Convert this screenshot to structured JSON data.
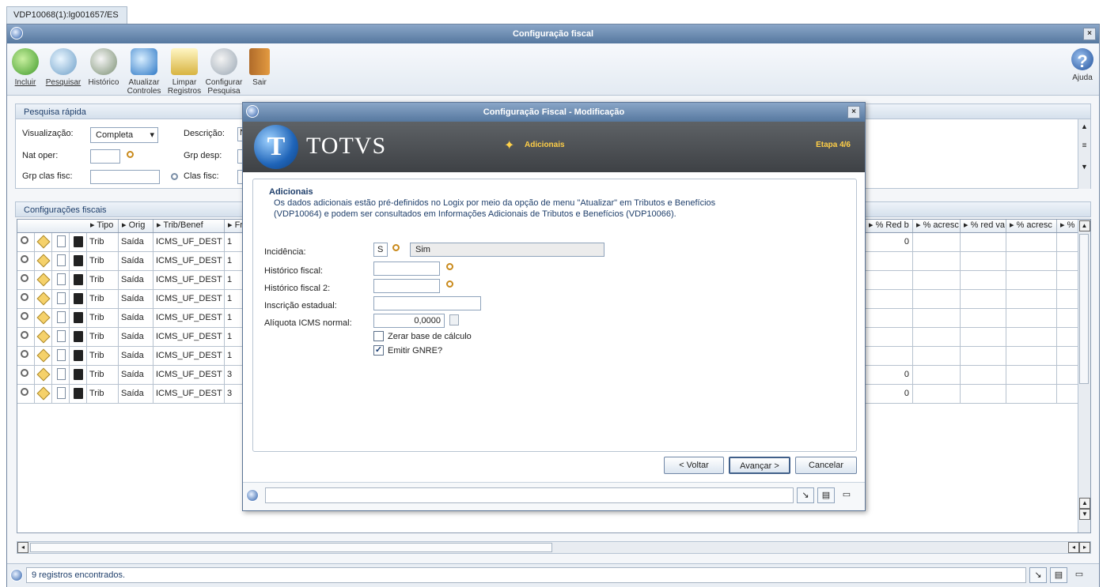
{
  "window_tab": "VDP10068(1):lg001657/ES",
  "main_title": "Configuração fiscal",
  "toolbar": {
    "incluir": "Incluir",
    "pesquisar": "Pesquisar",
    "historico": "Histórico",
    "atualizar_1": "Atualizar",
    "atualizar_2": "Controles",
    "limpar_1": "Limpar",
    "limpar_2": "Registros",
    "configurar_1": "Configurar",
    "configurar_2": "Pesquisa",
    "sair": "Sair",
    "ajuda": "Ajuda"
  },
  "quick_search": {
    "title": "Pesquisa rápida",
    "visualizacao_label": "Visualização:",
    "visualizacao_value": "Completa",
    "descricao_label": "Descrição:",
    "descricao_value": "N",
    "nat_oper_label": "Nat oper:",
    "grp_desp_label": "Grp desp:",
    "grp_clas_fisc_label": "Grp clas fisc:",
    "clas_fisc_label": "Clas fisc:"
  },
  "grid": {
    "title": "Configurações fiscais",
    "columns_left": [
      "Tipo",
      "Orig",
      "Trib/Benef",
      "Fr"
    ],
    "columns_right": [
      "% Red b",
      "% acresc",
      "% red va",
      "% acresc",
      "%"
    ],
    "rows": [
      {
        "tipo": "Trib",
        "orig": "Saída",
        "trib": "ICMS_UF_DEST",
        "fr": "1",
        "red": "0"
      },
      {
        "tipo": "Trib",
        "orig": "Saída",
        "trib": "ICMS_UF_DEST",
        "fr": "1",
        "red": ""
      },
      {
        "tipo": "Trib",
        "orig": "Saída",
        "trib": "ICMS_UF_DEST",
        "fr": "1",
        "red": ""
      },
      {
        "tipo": "Trib",
        "orig": "Saída",
        "trib": "ICMS_UF_DEST",
        "fr": "1",
        "red": ""
      },
      {
        "tipo": "Trib",
        "orig": "Saída",
        "trib": "ICMS_UF_DEST",
        "fr": "1",
        "red": ""
      },
      {
        "tipo": "Trib",
        "orig": "Saída",
        "trib": "ICMS_UF_DEST",
        "fr": "1",
        "red": ""
      },
      {
        "tipo": "Trib",
        "orig": "Saída",
        "trib": "ICMS_UF_DEST",
        "fr": "1",
        "red": ""
      },
      {
        "tipo": "Trib",
        "orig": "Saída",
        "trib": "ICMS_UF_DEST",
        "fr": "3",
        "red": "0"
      },
      {
        "tipo": "Trib",
        "orig": "Saída",
        "trib": "ICMS_UF_DEST",
        "fr": "3",
        "red": "0"
      }
    ]
  },
  "status": "9 registros encontrados.",
  "modal": {
    "title": "Configuração Fiscal - Modificação",
    "brand": "TOTVS",
    "step_name": "Adicionais",
    "step": "Etapa 4/6",
    "section_title": "Adicionais",
    "desc_line1": "Os dados adicionais estão pré-definidos no Logix por meio da opção de menu \"Atualizar\" em Tributos e Benefícios",
    "desc_line2": "(VDP10064) e podem ser consultados em Informações Adicionais de Tributos e Benefícios (VDP10066).",
    "incidencia_label": "Incidência:",
    "incidencia_code": "S",
    "incidencia_desc": "Sim",
    "historico_label": "Histórico fiscal:",
    "historico2_label": "Histórico fiscal 2:",
    "inscricao_label": "Inscrição estadual:",
    "aliquota_label": "Alíquota ICMS normal:",
    "aliquota_value": "0,0000",
    "zerar_label": "Zerar base de cálculo",
    "zerar_checked": false,
    "gnre_label": "Emitir GNRE?",
    "gnre_checked": true,
    "btn_voltar": "< Voltar",
    "btn_avancar": "Avançar >",
    "btn_cancelar": "Cancelar"
  }
}
